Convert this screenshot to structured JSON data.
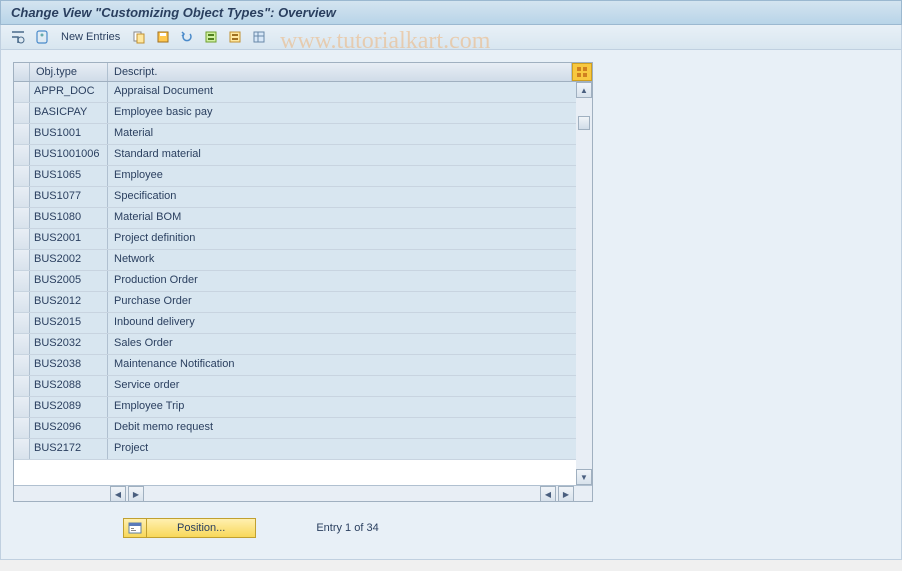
{
  "title": "Change View \"Customizing Object Types\": Overview",
  "toolbar": {
    "new_entries": "New Entries"
  },
  "watermark": "www.tutorialkart.com",
  "table": {
    "headers": {
      "obj_type": "Obj.type",
      "description": "Descript."
    },
    "rows": [
      {
        "obj": "APPR_DOC",
        "desc": "Appraisal Document"
      },
      {
        "obj": "BASICPAY",
        "desc": "Employee basic pay"
      },
      {
        "obj": "BUS1001",
        "desc": "Material"
      },
      {
        "obj": "BUS1001006",
        "desc": "Standard material"
      },
      {
        "obj": "BUS1065",
        "desc": "Employee"
      },
      {
        "obj": "BUS1077",
        "desc": "Specification"
      },
      {
        "obj": "BUS1080",
        "desc": "Material BOM"
      },
      {
        "obj": "BUS2001",
        "desc": "Project definition"
      },
      {
        "obj": "BUS2002",
        "desc": "Network"
      },
      {
        "obj": "BUS2005",
        "desc": "Production Order"
      },
      {
        "obj": "BUS2012",
        "desc": "Purchase Order"
      },
      {
        "obj": "BUS2015",
        "desc": "Inbound delivery"
      },
      {
        "obj": "BUS2032",
        "desc": "Sales Order"
      },
      {
        "obj": "BUS2038",
        "desc": "Maintenance Notification"
      },
      {
        "obj": "BUS2088",
        "desc": "Service order"
      },
      {
        "obj": "BUS2089",
        "desc": "Employee Trip"
      },
      {
        "obj": "BUS2096",
        "desc": "Debit memo request"
      },
      {
        "obj": "BUS2172",
        "desc": "Project"
      }
    ]
  },
  "footer": {
    "position": "Position...",
    "entry_status": "Entry 1 of 34"
  }
}
